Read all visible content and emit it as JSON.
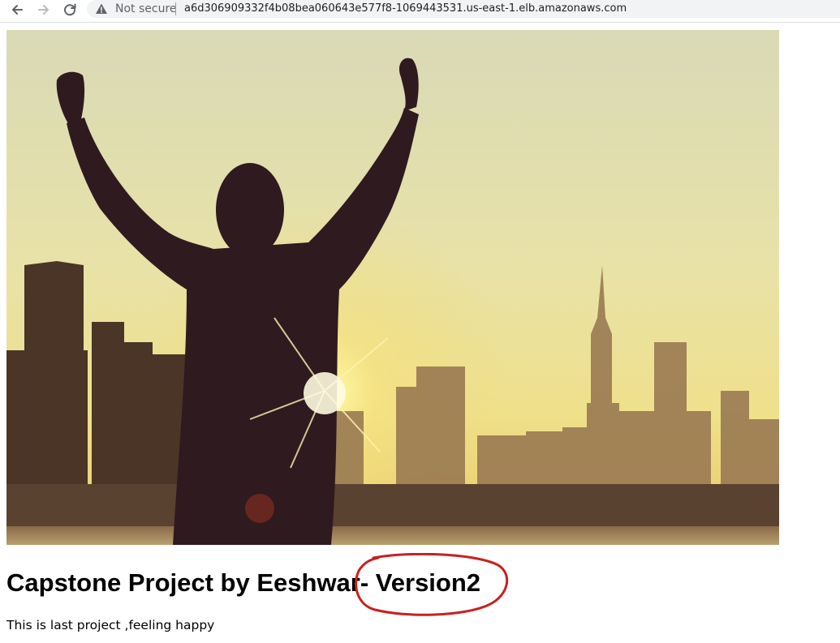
{
  "browser": {
    "security_label": "Not secure",
    "url": "a6d306909332f4b08bea060643e577f8-1069443531.us-east-1.elb.amazonaws.com",
    "icons": {
      "back": "arrow-left",
      "forward": "arrow-right",
      "reload": "reload",
      "security": "warning-triangle"
    }
  },
  "page": {
    "heading": "Capstone Project by Eeshwar- Version2",
    "paragraph": "This is last project ,feeling happy",
    "annotation_color": "#c8201f"
  }
}
